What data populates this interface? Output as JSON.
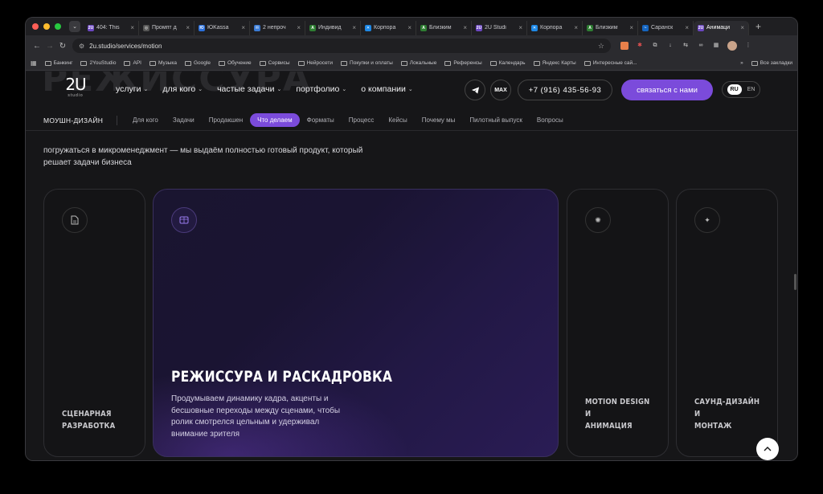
{
  "browser": {
    "tabs": [
      {
        "title": "404: This",
        "fav": "2U",
        "color": "#6b46c1"
      },
      {
        "title": "Промпт д",
        "fav": "◎",
        "color": "#555"
      },
      {
        "title": "ЮKassa",
        "fav": "Ю",
        "color": "#2a6fdb"
      },
      {
        "title": "2 непроч",
        "fav": "✉",
        "color": "#3a7bd5"
      },
      {
        "title": "Индивид",
        "fav": "A",
        "color": "#2e7d32"
      },
      {
        "title": "Корпора",
        "fav": "✕",
        "color": "#1e88e5"
      },
      {
        "title": "Близким",
        "fav": "A",
        "color": "#2e7d32"
      },
      {
        "title": "2U Studi",
        "fav": "2U",
        "color": "#6b46c1"
      },
      {
        "title": "Корпора",
        "fav": "✕",
        "color": "#1e88e5"
      },
      {
        "title": "Близким",
        "fav": "A",
        "color": "#2e7d32"
      },
      {
        "title": "Саранск",
        "fav": "~",
        "color": "#1565c0"
      },
      {
        "title": "Анимаци",
        "fav": "2U",
        "color": "#6b46c1"
      }
    ],
    "url": "2u.studio/services/motion",
    "bookmarks": [
      "Банкинг",
      "2YouStudio",
      "API",
      "Музыка",
      "Google",
      "Обучение",
      "Сервисы",
      "Нейросети",
      "Покупки и оплаты",
      "Локальные",
      "Референсы",
      "Календарь",
      "Яндекс Карты",
      "Интересные сай..."
    ],
    "more_bookmarks": "»",
    "all_bookmarks": "Все закладки"
  },
  "site": {
    "ghost_title": "РЕЖИССУРА",
    "logo": {
      "mark": "2U",
      "sub": "studio"
    },
    "menu": [
      "услуги",
      "для кого",
      "частые задачи",
      "портфолио",
      "о компании"
    ],
    "max_label": "MAX",
    "phone": "+7 (916) 435-56-93",
    "cta": "связаться с нами",
    "lang": {
      "ru": "RU",
      "en": "EN"
    },
    "subnav": {
      "label": "МОУШН-ДИЗАЙН",
      "items": [
        "Для кого",
        "Задачи",
        "Продакшен",
        "Что делаем",
        "Форматы",
        "Процесс",
        "Кейсы",
        "Почему мы",
        "Пилотный выпуск",
        "Вопросы"
      ],
      "active_index": 3
    },
    "intro": "погружаться в микроменеджмент — мы выдаём полностью готовый продукт, который решает задачи бизнеса",
    "cards": {
      "c1": {
        "title_l1": "СЦЕНАРНАЯ",
        "title_l2": "РАЗРАБОТКА",
        "icon": "document-icon"
      },
      "main": {
        "title": "РЕЖИССУРА И РАСКАДРОВКА",
        "text": "Продумываем динамику кадра, акценты и бесшовные переходы между сценами, чтобы ролик смотрелся цельным и удерживал внимание зрителя",
        "icon": "storyboard-icon"
      },
      "c3": {
        "title_l1": "MOTION DESIGN И",
        "title_l2": "АНИМАЦИЯ",
        "icon": "sparkle-icon"
      },
      "c4": {
        "title_l1": "САУНД-ДИЗАЙН И",
        "title_l2": "МОНТАЖ",
        "icon": "sound-icon"
      }
    },
    "accent": "#7b4bdb"
  }
}
